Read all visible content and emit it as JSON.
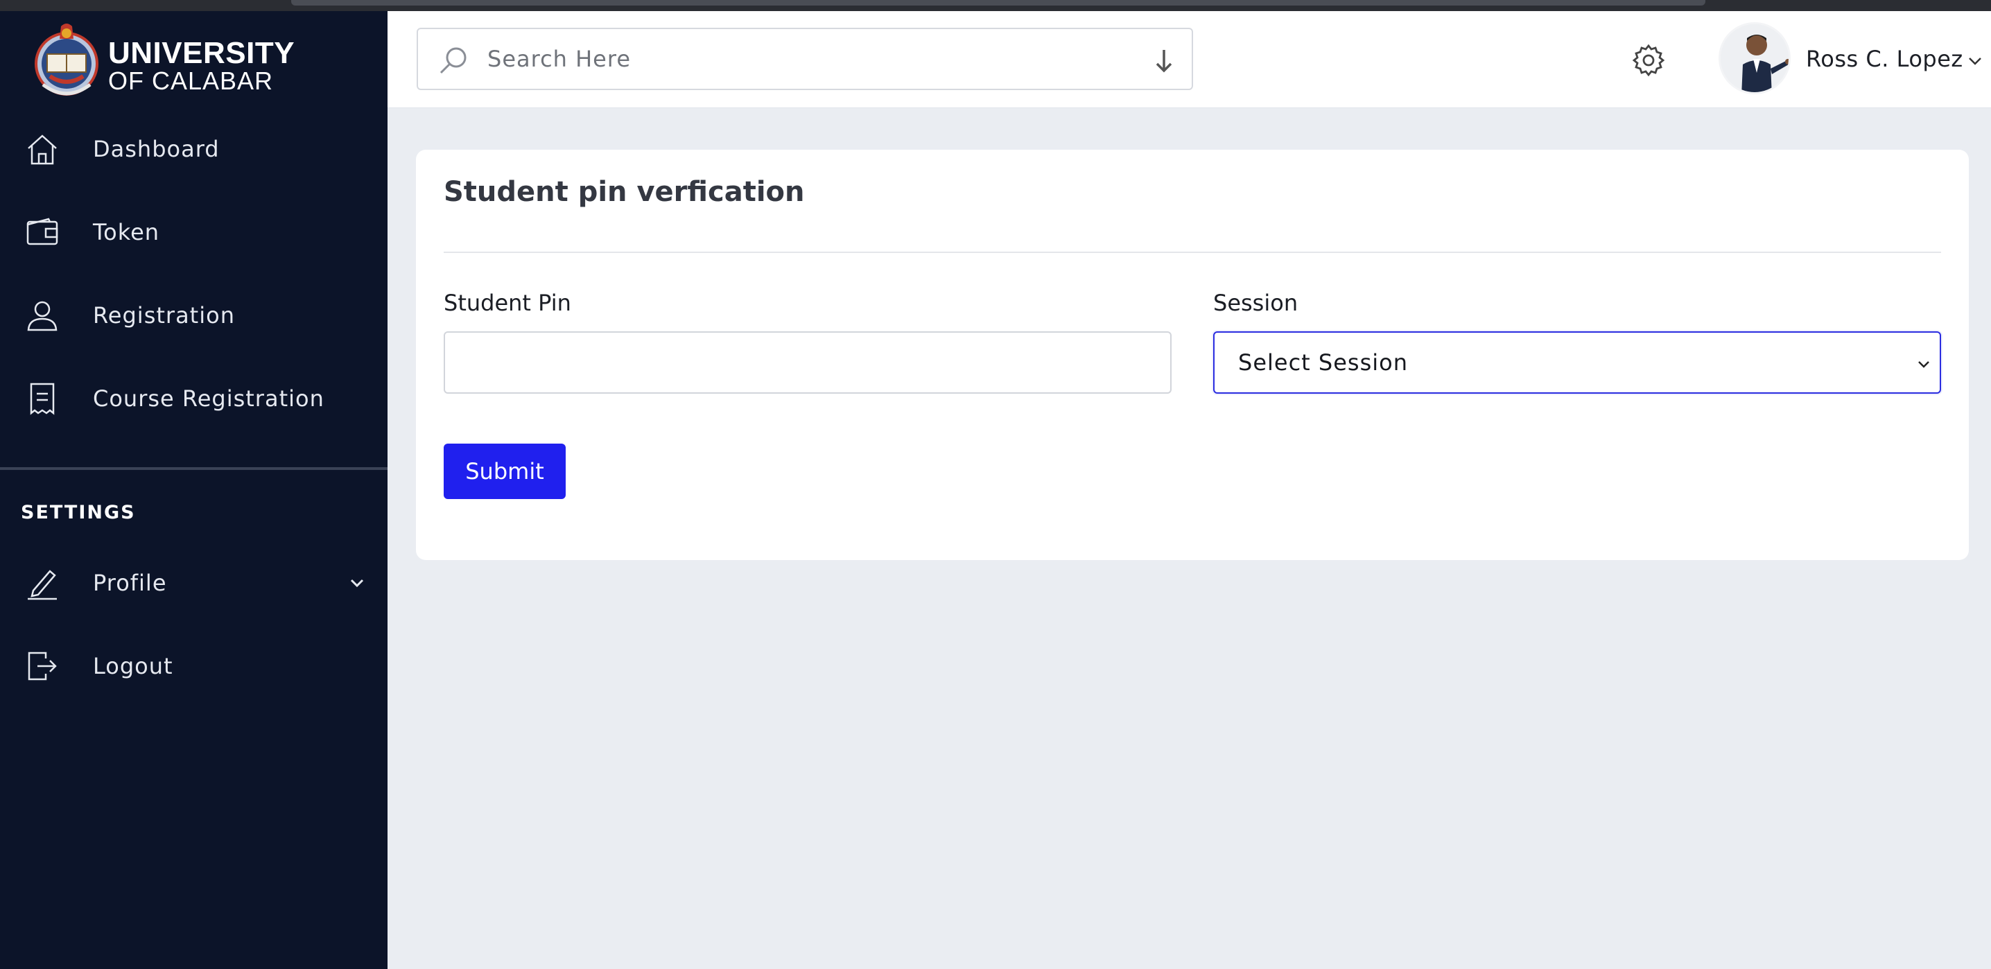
{
  "brand": {
    "line1": "UNIVERSITY",
    "line2": "OF CALABAR",
    "colors": {
      "sidebar_bg": "#0c1429",
      "accent": "#2020ee"
    }
  },
  "sidebar": {
    "items": [
      {
        "label": "Dashboard",
        "icon": "home-icon"
      },
      {
        "label": "Token",
        "icon": "wallet-icon"
      },
      {
        "label": "Registration",
        "icon": "user-icon"
      },
      {
        "label": "Course Registration",
        "icon": "receipt-icon"
      }
    ],
    "settings_title": "SETTINGS",
    "settings_items": [
      {
        "label": "Profile",
        "icon": "pencil-icon",
        "has_submenu": true
      },
      {
        "label": "Logout",
        "icon": "logout-icon"
      }
    ]
  },
  "header": {
    "search": {
      "placeholder": "Search Here",
      "value": ""
    },
    "user": {
      "name": "Ross C. Lopez"
    }
  },
  "card": {
    "title": "Student pin verfication",
    "pin_field": {
      "label": "Student Pin",
      "value": ""
    },
    "session_field": {
      "label": "Session",
      "selected": "Select Session"
    },
    "submit_label": "Submit"
  }
}
